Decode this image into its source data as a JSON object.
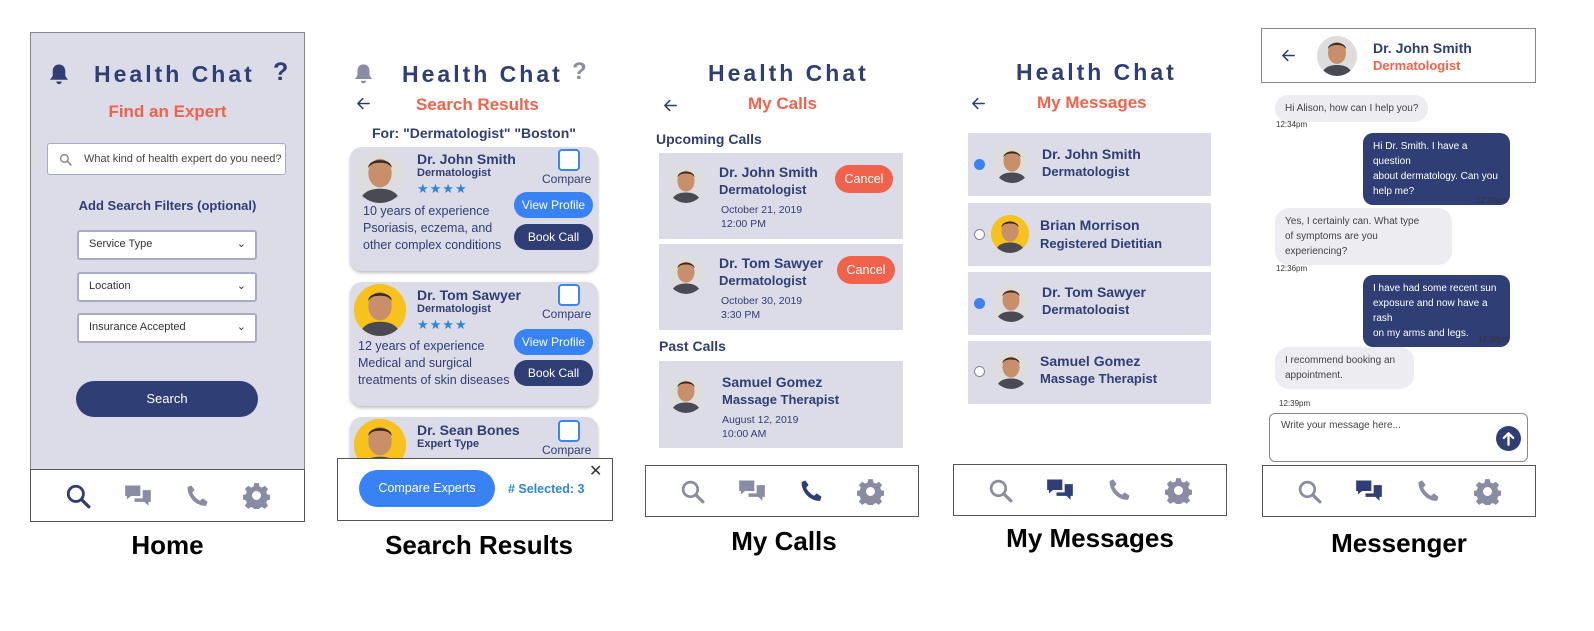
{
  "app_title": "Health Chat",
  "captions": {
    "home": "Home",
    "search_results": "Search Results",
    "my_calls": "My Calls",
    "my_messages": "My Messages",
    "messenger": "Messenger"
  },
  "home": {
    "heading": "Find an Expert",
    "search_placeholder": "What kind of health expert do you need?",
    "filters_heading": "Add Search Filters (optional)",
    "filters": [
      "Service Type",
      "Location",
      "Insurance Accepted"
    ],
    "search_button": "Search"
  },
  "search_results": {
    "heading": "Search Results",
    "query": "For: \"Dermatologist\" \"Boston\"",
    "compare_label": "Compare",
    "view_profile": "View Profile",
    "book_call": "Book Call",
    "results": [
      {
        "name": "Dr. John Smith",
        "specialty": "Dermatologist",
        "stars": "★★★★",
        "desc_lines": [
          "10 years of experience",
          "Psoriasis, eczema, and",
          "other complex conditions"
        ]
      },
      {
        "name": "Dr. Tom Sawyer",
        "specialty": "Dermatologist",
        "stars": "★★★★",
        "desc_lines": [
          "12 years of experience",
          "Medical and surgical",
          "treatments of skin diseases"
        ]
      },
      {
        "name": "Dr. Sean Bones",
        "specialty": "Expert Type"
      }
    ],
    "compare_button": "Compare Experts",
    "selected_count": "# Selected: 3"
  },
  "my_calls": {
    "heading": "My Calls",
    "upcoming_label": "Upcoming Calls",
    "past_label": "Past Calls",
    "cancel_label": "Cancel",
    "upcoming": [
      {
        "name": "Dr. John Smith",
        "role": "Dermatologist",
        "date": "October 21, 2019",
        "time": "12:00 PM"
      },
      {
        "name": "Dr. Tom Sawyer",
        "role": "Dermatologist",
        "date": "October 30, 2019",
        "time": "3:30 PM"
      }
    ],
    "past": [
      {
        "name": "Samuel Gomez",
        "role": "Massage Therapist",
        "date": "August 12, 2019",
        "time": "10:00 AM"
      }
    ]
  },
  "my_messages": {
    "heading": "My Messages",
    "threads": [
      {
        "name": "Dr. John Smith",
        "role": "Dermatologist",
        "unread": true
      },
      {
        "name": "Brian Morrison",
        "role": "Registered Dietitian",
        "unread": false
      },
      {
        "name": "Dr. Tom Sawyer",
        "role": "Dermatologist",
        "unread": true
      },
      {
        "name": "Samuel Gomez",
        "role": "Massage Therapist",
        "unread": false
      }
    ]
  },
  "messenger": {
    "contact_name": "Dr. John Smith",
    "contact_role": "Dermatologist",
    "messages": [
      {
        "from": "expert",
        "lines": [
          "Hi Alison, how can I help you?"
        ],
        "time": "12:34pm"
      },
      {
        "from": "user",
        "lines": [
          "Hi Dr. Smith. I have a question",
          "about dermatology. Can you",
          "help me?"
        ],
        "time": "12:35pm"
      },
      {
        "from": "expert",
        "lines": [
          "Yes, I certainly can. What type",
          "of symptoms are you experiencing?"
        ],
        "time": "12:36pm"
      },
      {
        "from": "user",
        "lines": [
          "I have had some recent sun",
          "exposure and now have a rash",
          "on my arms and legs."
        ],
        "time": "12:38pm"
      },
      {
        "from": "expert",
        "lines": [
          "I recommend booking an",
          "appointment."
        ],
        "time": "12:39pm"
      }
    ],
    "input_placeholder": "Write your message here..."
  },
  "colors": {
    "navy": "#2f3e74",
    "coral": "#f0624b",
    "blue": "#3882f3",
    "panel": "#dcdbe8",
    "star": "#2e86d6",
    "nav_inactive": "#8a8ca3"
  },
  "icons": {
    "nav": [
      "search-icon",
      "chat-icon",
      "phone-icon",
      "gear-icon"
    ],
    "header": [
      "bell-icon",
      "help-icon",
      "back-arrow-icon"
    ]
  }
}
